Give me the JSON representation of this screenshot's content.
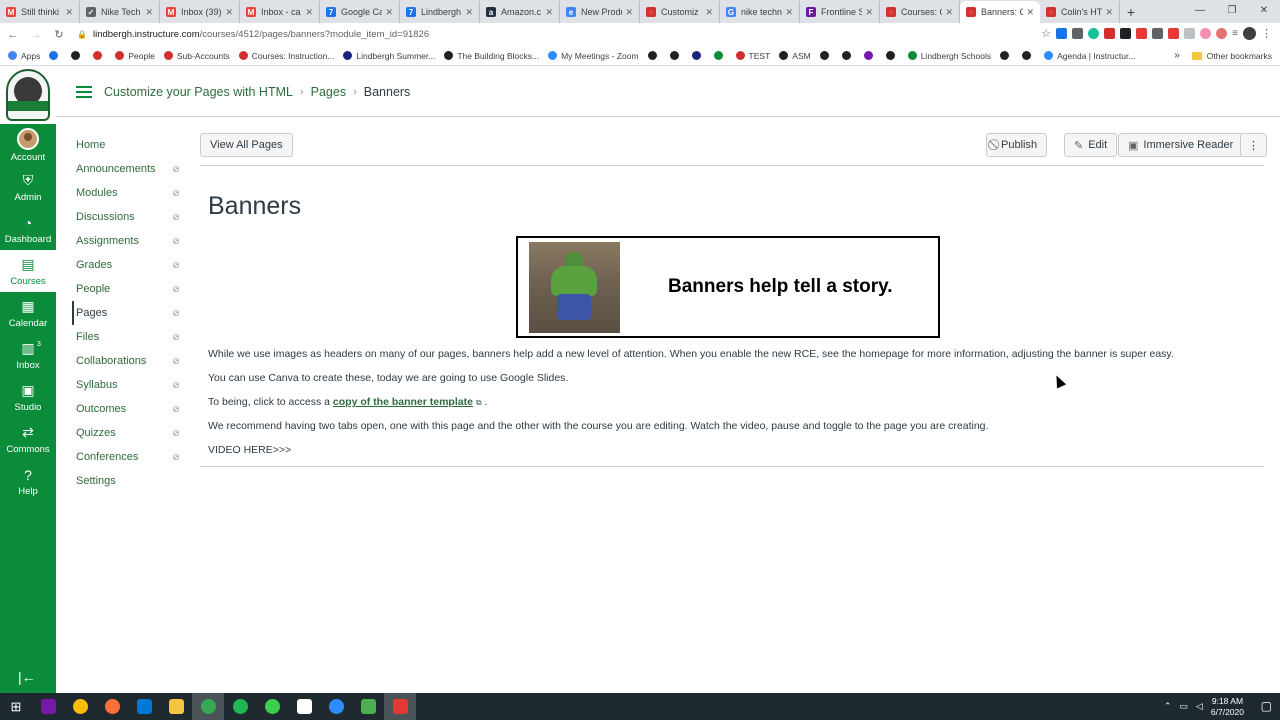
{
  "browser": {
    "tabs": [
      {
        "title": "Still thinki",
        "color": "#ea4335",
        "glyph": "M"
      },
      {
        "title": "Nike Tech",
        "color": "#5f6368",
        "glyph": "✓"
      },
      {
        "title": "Inbox (39)",
        "color": "#ea4335",
        "glyph": "M"
      },
      {
        "title": "Inbox - ca",
        "color": "#ea4335",
        "glyph": "M"
      },
      {
        "title": "Google Ca",
        "color": "#1a73e8",
        "glyph": "7"
      },
      {
        "title": "Lindbergh",
        "color": "#1a73e8",
        "glyph": "7"
      },
      {
        "title": "Amazon.c",
        "color": "#232f3e",
        "glyph": "a"
      },
      {
        "title": "New Produ",
        "color": "#4285f4",
        "glyph": "e"
      },
      {
        "title": "Customiz",
        "color": "#d32f2f",
        "glyph": "◌"
      },
      {
        "title": "nike techn",
        "color": "#4285f4",
        "glyph": "G"
      },
      {
        "title": "Frontline S",
        "color": "#6a1b9a",
        "glyph": "F"
      },
      {
        "title": "Courses: C",
        "color": "#d32f2f",
        "glyph": "◌"
      },
      {
        "title": "Banners: C",
        "color": "#d32f2f",
        "glyph": "◌",
        "active": true
      },
      {
        "title": "Colin's HT",
        "color": "#d32f2f",
        "glyph": "◌"
      }
    ],
    "new_tab": "+",
    "url_host": "lindbergh.instructure.com",
    "url_path": "/courses/4512/pages/banners?module_item_id=91826",
    "bookmarks": [
      {
        "label": "Apps",
        "color": "#4285f4"
      },
      {
        "label": "",
        "color": "#1a73e8"
      },
      {
        "label": "",
        "color": "#202124"
      },
      {
        "label": "",
        "color": "#d32f2f"
      },
      {
        "label": "People",
        "color": "#d32f2f"
      },
      {
        "label": "Sub-Accounts",
        "color": "#d32f2f"
      },
      {
        "label": "Courses: Instruction...",
        "color": "#d32f2f"
      },
      {
        "label": "Lindbergh Summer...",
        "color": "#1a237e"
      },
      {
        "label": "The Building Blocks...",
        "color": "#202124"
      },
      {
        "label": "My Meetings - Zoom",
        "color": "#2d8cff"
      },
      {
        "label": "",
        "color": "#202124"
      },
      {
        "label": "",
        "color": "#202124"
      },
      {
        "label": "",
        "color": "#1a237e"
      },
      {
        "label": "",
        "color": "#0b8c3a"
      },
      {
        "label": "TEST",
        "color": "#d32f2f"
      },
      {
        "label": "ASM",
        "color": "#202124"
      },
      {
        "label": "",
        "color": "#202124"
      },
      {
        "label": "",
        "color": "#202124"
      },
      {
        "label": "",
        "color": "#7719aa"
      },
      {
        "label": "",
        "color": "#202124"
      },
      {
        "label": "Lindbergh Schools",
        "color": "#0b8c3a"
      },
      {
        "label": "",
        "color": "#202124"
      },
      {
        "label": "",
        "color": "#202124"
      },
      {
        "label": "Agenda | Instructur...",
        "color": "#2d8cff"
      }
    ],
    "bookmarks_more": "»",
    "other_bookmarks": "Other bookmarks"
  },
  "global_nav": {
    "items": [
      {
        "label": "Account",
        "icon": "avatar"
      },
      {
        "label": "Admin",
        "icon": "shield-icon",
        "glyph": "⛨"
      },
      {
        "label": "Dashboard",
        "icon": "dashboard-icon",
        "glyph": "◔"
      },
      {
        "label": "Courses",
        "icon": "courses-icon",
        "glyph": "▤",
        "active": true
      },
      {
        "label": "Calendar",
        "icon": "calendar-icon",
        "glyph": "▦"
      },
      {
        "label": "Inbox",
        "icon": "inbox-icon",
        "glyph": "▥",
        "badge": "3"
      },
      {
        "label": "Studio",
        "icon": "studio-icon",
        "glyph": "▣"
      },
      {
        "label": "Commons",
        "icon": "commons-icon",
        "glyph": "⇄"
      },
      {
        "label": "Help",
        "icon": "help-icon",
        "glyph": "?"
      }
    ],
    "collapse_glyph": "|←"
  },
  "breadcrumb": {
    "course": "Customize your Pages with HTML",
    "section": "Pages",
    "current": "Banners",
    "sep": "›"
  },
  "course_nav": {
    "items": [
      {
        "label": "Home",
        "hidden": false
      },
      {
        "label": "Announcements",
        "hidden": true
      },
      {
        "label": "Modules",
        "hidden": true
      },
      {
        "label": "Discussions",
        "hidden": true
      },
      {
        "label": "Assignments",
        "hidden": true
      },
      {
        "label": "Grades",
        "hidden": true
      },
      {
        "label": "People",
        "hidden": true
      },
      {
        "label": "Pages",
        "hidden": true,
        "active": true
      },
      {
        "label": "Files",
        "hidden": true
      },
      {
        "label": "Collaborations",
        "hidden": true
      },
      {
        "label": "Syllabus",
        "hidden": true
      },
      {
        "label": "Outcomes",
        "hidden": true
      },
      {
        "label": "Quizzes",
        "hidden": true
      },
      {
        "label": "Conferences",
        "hidden": true
      },
      {
        "label": "Settings",
        "hidden": false
      }
    ]
  },
  "toolbar": {
    "view_all": "View All Pages",
    "publish": "Publish",
    "edit": "Edit",
    "immersive_reader": "Immersive Reader",
    "more": "⋮"
  },
  "page": {
    "title": "Banners",
    "banner_text": "Banners help tell a story.",
    "p1": "While we use images as headers on many of our pages, banners help add a new level of attention.  When you enable the new RCE, see the homepage for more information, adjusting the banner is super easy.",
    "p2": "You can use Canva to create these, today we are going to use Google Slides.",
    "p3_before": "To being, click to access a ",
    "p3_link": "copy of the banner template",
    "p3_after": " .",
    "p4": "We recommend having two tabs open, one with this page and the other with the course you are editing. Watch the video, pause and toggle to the page you are creating.",
    "p5": "VIDEO HERE>>>"
  },
  "taskbar": {
    "apps": [
      {
        "name": "onenote",
        "color": "#7719aa"
      },
      {
        "name": "chrome",
        "color": "#fbbc05"
      },
      {
        "name": "firefox",
        "color": "#ff7139"
      },
      {
        "name": "edge",
        "color": "#0078d7"
      },
      {
        "name": "file-explorer",
        "color": "#f4c542"
      },
      {
        "name": "chrome-profile",
        "color": "#34a853",
        "active": true
      },
      {
        "name": "spotify",
        "color": "#1db954"
      },
      {
        "name": "app-green",
        "color": "#3ccf4e"
      },
      {
        "name": "app-mountain",
        "color": "#ffffff"
      },
      {
        "name": "zoom",
        "color": "#2d8cff"
      },
      {
        "name": "camtasia",
        "color": "#4caf50"
      },
      {
        "name": "snagit",
        "color": "#e53935",
        "active": true
      }
    ],
    "time": "9:18 AM",
    "date": "6/7/2020"
  }
}
